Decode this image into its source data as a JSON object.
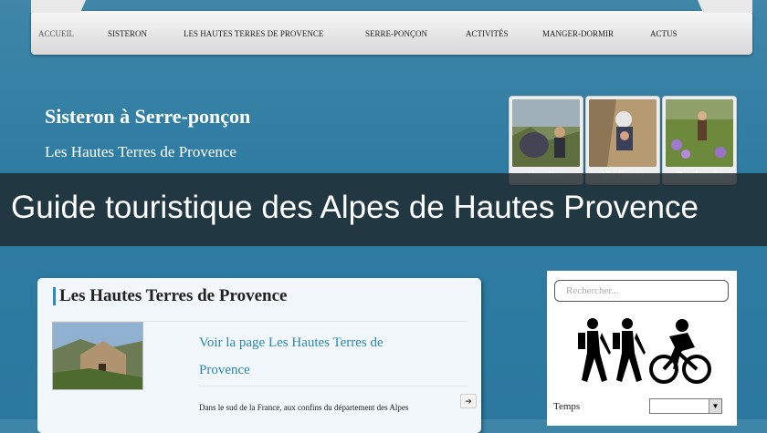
{
  "nav": {
    "items": [
      {
        "label": "ACCUEIL",
        "active": true
      },
      {
        "label": "SISTERON"
      },
      {
        "label": "LES HAUTES TERRES DE PROVENCE"
      },
      {
        "label": "SERRE-PONÇON"
      },
      {
        "label": "ACTIVITÉS"
      },
      {
        "label": "MANGER-DORMIR"
      },
      {
        "label": "ACTUS"
      }
    ]
  },
  "header": {
    "title": "Sisteron à Serre-ponçon",
    "subtitle": "Les Hautes Terres de Provence"
  },
  "thumbnails": [
    {
      "caption": "Insolite"
    },
    {
      "caption": "Via ferrata"
    },
    {
      "caption": "Randonnée"
    }
  ],
  "banner": {
    "text": "Guide touristique des Alpes de Hautes Provence"
  },
  "main": {
    "title": "Les Hautes Terres de Provence",
    "link": "Voir la page Les Hautes Terres de Provence",
    "excerpt": "Dans le sud de la France, aux confins du département des Alpes"
  },
  "sidebar": {
    "search_placeholder": "Rechercher...",
    "temps_label": "Temps",
    "temps_value": ""
  },
  "colors": {
    "accent": "#2b8ac9",
    "background": "#2f7ca3"
  }
}
